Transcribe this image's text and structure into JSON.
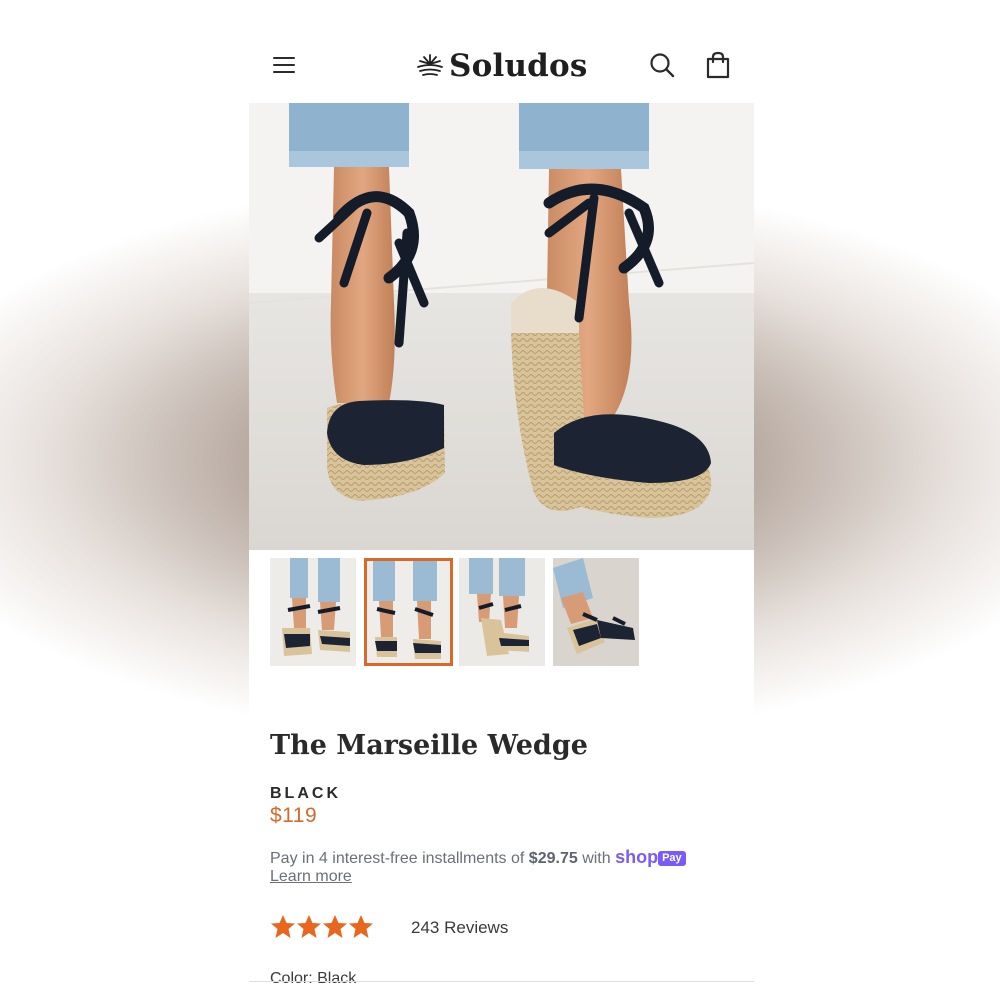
{
  "brand": {
    "name": "Soludos"
  },
  "header": {
    "menu_icon": "hamburger-menu-icon",
    "search_icon": "search-icon",
    "cart_icon": "shopping-bag-icon"
  },
  "product": {
    "title": "The Marseille Wedge",
    "color_name": "BLACK",
    "price": "$119",
    "installments": {
      "prefix": "Pay in 4 interest-free installments of",
      "amount": "$29.75",
      "suffix": "with",
      "provider": "shop",
      "provider_badge": "Pay",
      "learn_more": "Learn more"
    },
    "rating": {
      "value": 4.5,
      "max": 5,
      "reviews_label": "243 Reviews"
    },
    "color_line": "Color: Black"
  },
  "gallery": {
    "thumbnail_count": 4,
    "selected_index": 1
  },
  "colors": {
    "accent": "#d56a2a",
    "shop_purple": "#7a5af8",
    "text": "#2a2a2a"
  }
}
